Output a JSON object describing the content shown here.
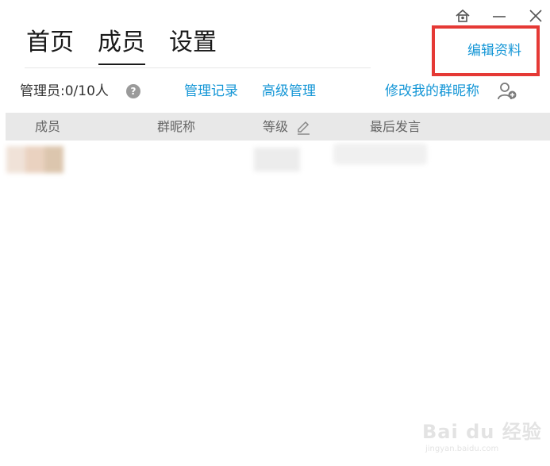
{
  "tabs": [
    {
      "label": "首页",
      "active": false
    },
    {
      "label": "成员",
      "active": true
    },
    {
      "label": "设置",
      "active": false
    }
  ],
  "edit_profile_label": "编辑资料",
  "admin": {
    "label": "管理员:0/10人",
    "help": "?"
  },
  "links": {
    "manage_records": "管理记录",
    "advanced_manage": "高级管理",
    "change_nickname": "修改我的群昵称"
  },
  "table": {
    "headers": [
      "成员",
      "群昵称",
      "等级",
      "最后发言"
    ]
  },
  "window_controls": [
    "home-icon",
    "minimize-icon",
    "close-icon"
  ],
  "watermark": {
    "main": "Bai du 经验",
    "sub": "jingyan.baidu.com"
  },
  "colors": {
    "link": "#1496d6",
    "highlight": "#e53935",
    "header_bg": "#e8e8e8"
  }
}
